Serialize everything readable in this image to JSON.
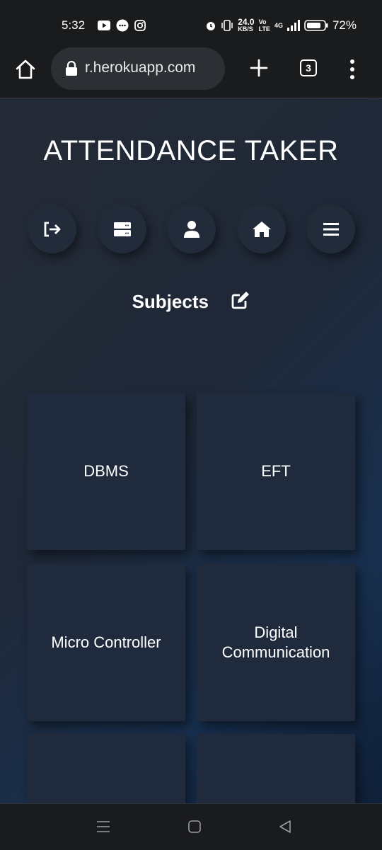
{
  "status_bar": {
    "time": "5:32",
    "net_speed": "24.0",
    "net_unit": "KB/S",
    "volte": "Vo",
    "lte": "LTE",
    "network": "4G",
    "battery": "72%"
  },
  "browser": {
    "url": "r.herokuapp.com",
    "tab_count": "3"
  },
  "app": {
    "title": "ATTENDANCE TAKER",
    "nav_icons": [
      "logout-icon",
      "server-icon",
      "user-icon",
      "home-icon",
      "menu-icon"
    ],
    "section_title": "Subjects",
    "subjects": [
      {
        "name": "DBMS"
      },
      {
        "name": "EFT"
      },
      {
        "name": "Micro Controller"
      },
      {
        "name": "Digital Communication"
      },
      {
        "name": ""
      },
      {
        "name": ""
      }
    ]
  },
  "colors": {
    "page_bg_start": "#252b36",
    "page_bg_end": "#0f2038",
    "card_bg": "#1f2b3d",
    "chrome_bg": "#1a1b1d"
  }
}
